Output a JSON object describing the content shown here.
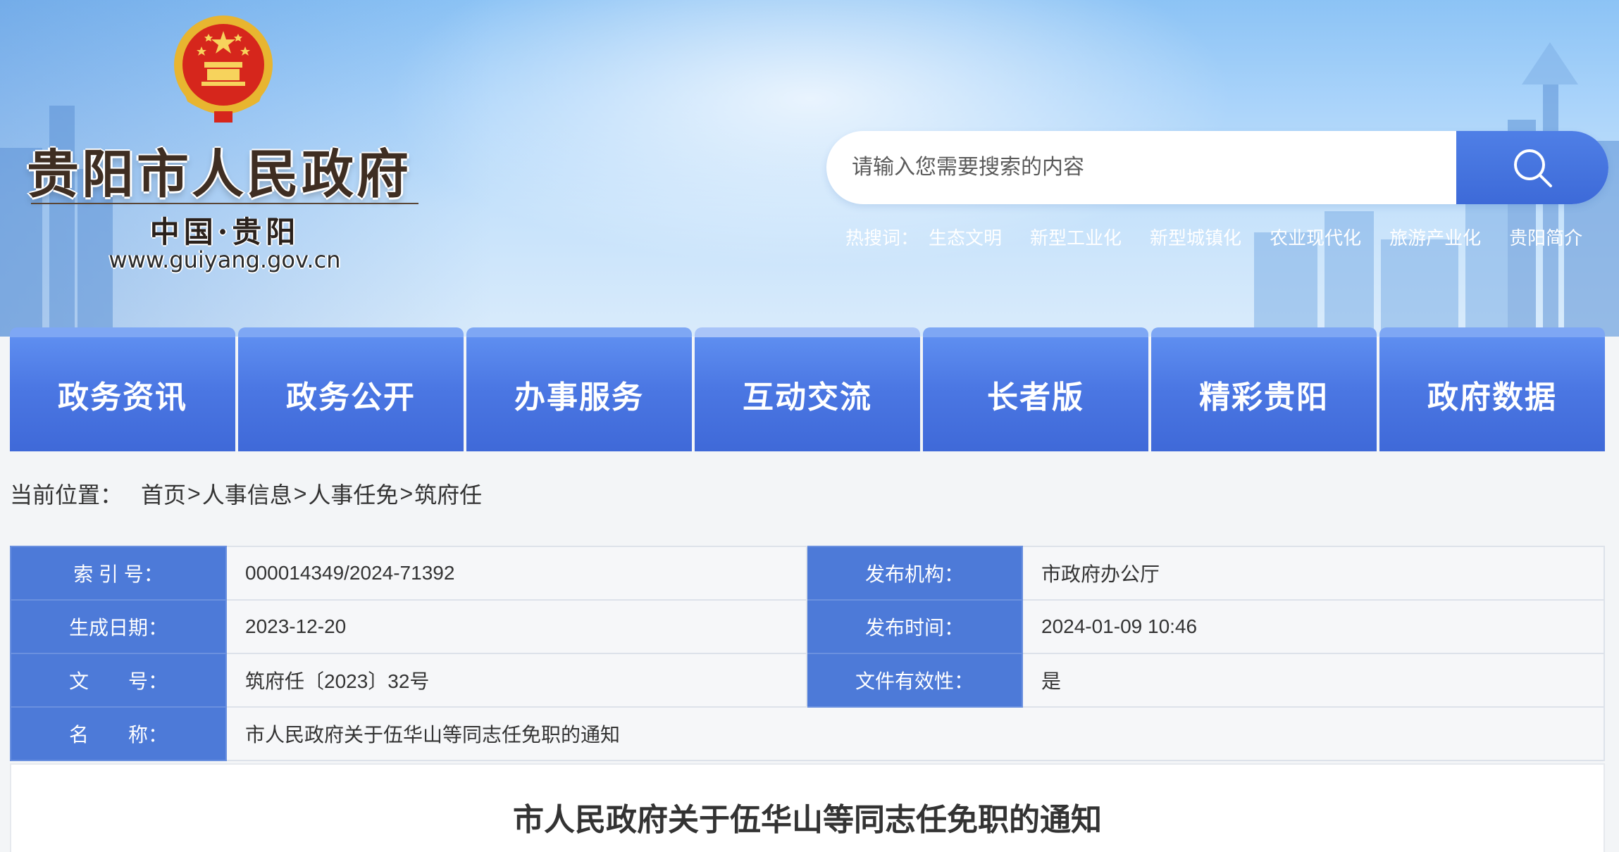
{
  "site": {
    "title": "贵阳市人民政府",
    "subtitle": "中国·贵阳",
    "url": "www.guiyang.gov.cn"
  },
  "search": {
    "placeholder": "请输入您需要搜索的内容",
    "icon": "search-icon"
  },
  "hot_words": {
    "label": "热搜词：",
    "items": [
      "生态文明",
      "新型工业化",
      "新型城镇化",
      "农业现代化",
      "旅游产业化",
      "贵阳简介"
    ]
  },
  "nav": {
    "items": [
      "政务资讯",
      "政务公开",
      "办事服务",
      "互动交流",
      "长者版",
      "精彩贵阳",
      "政府数据"
    ]
  },
  "breadcrumb": {
    "label": "当前位置：",
    "items": [
      "首页",
      "人事信息",
      "人事任免",
      "筑府任"
    ],
    "separator": ">"
  },
  "meta": {
    "index_label": "索 引 号：",
    "index_value": "000014349/2024-71392",
    "org_label": "发布机构：",
    "org_value": "市政府办公厅",
    "date_label": "生成日期：",
    "date_value": "2023-12-20",
    "pubtime_label": "发布时间：",
    "pubtime_value": "2024-01-09 10:46",
    "doc_label": "文　　号：",
    "doc_value": "筑府任〔2023〕32号",
    "valid_label": "文件有效性：",
    "valid_value": "是",
    "name_label": "名　　称：",
    "name_value": "市人民政府关于伍华山等同志任免职的通知"
  },
  "article": {
    "title": "市人民政府关于伍华山等同志任免职的通知"
  },
  "colors": {
    "nav": "#4b77e3",
    "label_cell": "#4d7ad8",
    "search_button": "#3d6ad8"
  }
}
